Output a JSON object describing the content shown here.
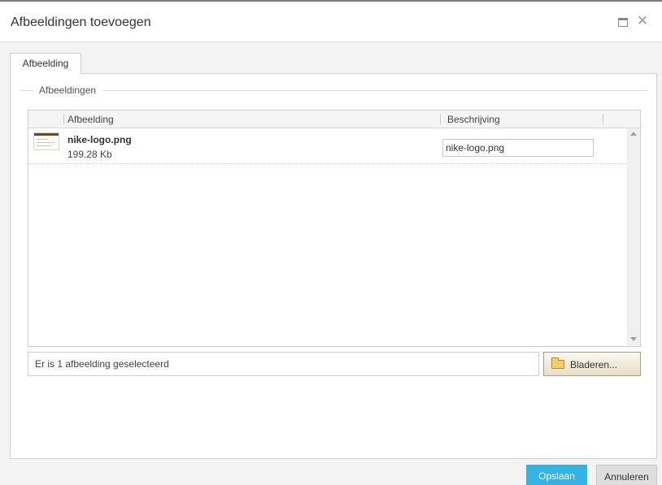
{
  "dialog": {
    "title": "Afbeeldingen toevoegen",
    "maximize_icon": "maximize-icon",
    "close_glyph": "✕"
  },
  "tabs": [
    {
      "label": "Afbeelding"
    }
  ],
  "fieldset": {
    "legend": "Afbeeldingen"
  },
  "grid": {
    "columns": [
      "Afbeelding",
      "Beschrijving"
    ],
    "rows": [
      {
        "filename": "nike-logo.png",
        "size": "199.28 Kb",
        "description": "nike-logo.png"
      }
    ]
  },
  "status": {
    "text": "Er is 1 afbeelding geselecteerd"
  },
  "buttons": {
    "browse": "Bladeren...",
    "save": "Opslaan",
    "cancel": "Annuleren"
  },
  "colors": {
    "save": "#35b3e5",
    "cancel": "#dedede",
    "browse": "#e6dfc8"
  }
}
